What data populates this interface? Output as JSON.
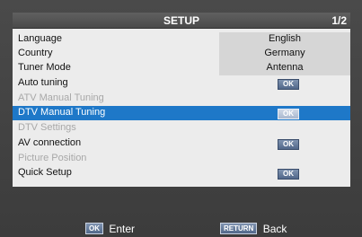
{
  "header": {
    "title": "SETUP",
    "page": "1/2"
  },
  "menu": [
    {
      "label": "Language",
      "value": "English"
    },
    {
      "label": "Country",
      "value": "Germany"
    },
    {
      "label": "Tuner Mode",
      "value": "Antenna"
    },
    {
      "label": "Auto tuning",
      "button": "OK"
    },
    {
      "label": "ATV Manual Tuning"
    },
    {
      "label": "DTV Manual Tuning",
      "button": "OK"
    },
    {
      "label": "DTV Settings"
    },
    {
      "label": "AV connection",
      "button": "OK"
    },
    {
      "label": "Picture Position"
    },
    {
      "label": "Quick Setup",
      "button": "OK"
    }
  ],
  "footer": {
    "enter_key": "OK",
    "enter_label": "Enter",
    "back_key": "RETURN",
    "back_label": "Back"
  },
  "colors": {
    "selection": "#1e78c8",
    "panel": "#ececec",
    "value_box": "#d6d6d6"
  }
}
